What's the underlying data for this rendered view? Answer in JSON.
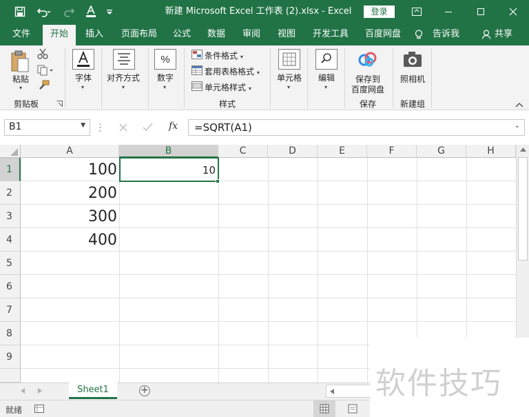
{
  "titlebar": {
    "title": "新建 Microsoft Excel 工作表 (2).xlsx - Excel",
    "login_label": "登录"
  },
  "tabs": [
    {
      "label": "文件"
    },
    {
      "label": "开始"
    },
    {
      "label": "插入"
    },
    {
      "label": "页面布局"
    },
    {
      "label": "公式"
    },
    {
      "label": "数据"
    },
    {
      "label": "审阅"
    },
    {
      "label": "视图"
    },
    {
      "label": "开发工具"
    },
    {
      "label": "百度网盘"
    },
    {
      "label": "告诉我"
    },
    {
      "label": "共享"
    }
  ],
  "ribbon": {
    "paste_label": "粘贴",
    "clipboard_group": "剪贴板",
    "font_label": "字体",
    "align_label": "对齐方式",
    "number_label": "数字",
    "cond_format": "条件格式",
    "table_format": "套用表格格式",
    "cell_style": "单元格样式",
    "styles_group": "样式",
    "cells_label": "单元格",
    "edit_label": "编辑",
    "save_line1": "保存到",
    "save_line2": "百度网盘",
    "save_group": "保存",
    "camera_label": "照相机",
    "newgroup": "新建组"
  },
  "formula_bar": {
    "name_box": "B1",
    "fx": "fx",
    "formula": "=SQRT(A1)"
  },
  "grid": {
    "columns": [
      "A",
      "B",
      "C",
      "D",
      "E",
      "F",
      "G",
      "H"
    ],
    "rows": [
      "1",
      "2",
      "3",
      "4",
      "5",
      "6",
      "7",
      "8",
      "9"
    ],
    "col_a_values": [
      "100",
      "200",
      "300",
      "400"
    ],
    "b1_value": "10"
  },
  "sheet": {
    "tab_name": "Sheet1",
    "add_symbol": "+"
  },
  "status": {
    "ready": "就绪"
  },
  "watermark": "软件技巧",
  "colors": {
    "accent": "#217346",
    "selection_border": "#217346"
  }
}
